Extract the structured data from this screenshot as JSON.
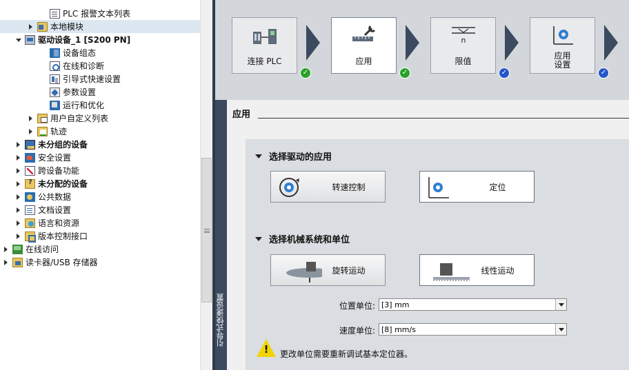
{
  "tree": {
    "items": [
      {
        "label": "PLC 报警文本列表",
        "arrow": "none",
        "icon": "doc",
        "bold": false
      },
      {
        "label": "本地模块",
        "arrow": "collapsed",
        "icon": "folder",
        "bold": false,
        "selected": true
      },
      {
        "label": "驱动设备_1 [S200 PN]",
        "arrow": "expanded",
        "icon": "drive",
        "bold": true
      },
      {
        "label": "设备组态",
        "arrow": "none",
        "icon": "config",
        "bold": false
      },
      {
        "label": "在线和诊断",
        "arrow": "none",
        "icon": "diag",
        "bold": false
      },
      {
        "label": "引导式快速设置",
        "arrow": "none",
        "icon": "wizard",
        "bold": false
      },
      {
        "label": "参数设置",
        "arrow": "none",
        "icon": "param",
        "bold": false
      },
      {
        "label": "运行和优化",
        "arrow": "none",
        "icon": "run",
        "bold": false
      },
      {
        "label": "用户自定义列表",
        "arrow": "collapsed",
        "icon": "userlist",
        "bold": false
      },
      {
        "label": "轨迹",
        "arrow": "collapsed",
        "icon": "trace",
        "bold": false
      },
      {
        "label": "未分组的设备",
        "arrow": "collapsed",
        "icon": "ungroup",
        "bold": true
      },
      {
        "label": "安全设置",
        "arrow": "collapsed",
        "icon": "security",
        "bold": false
      },
      {
        "label": "跨设备功能",
        "arrow": "collapsed",
        "icon": "cross",
        "bold": false
      },
      {
        "label": "未分配的设备",
        "arrow": "collapsed",
        "icon": "unassigned",
        "bold": true
      },
      {
        "label": "公共数据",
        "arrow": "collapsed",
        "icon": "common",
        "bold": false
      },
      {
        "label": "文档设置",
        "arrow": "collapsed",
        "icon": "docset",
        "bold": false
      },
      {
        "label": "语言和资源",
        "arrow": "collapsed",
        "icon": "lang",
        "bold": false
      },
      {
        "label": "版本控制接口",
        "arrow": "collapsed",
        "icon": "version",
        "bold": false
      },
      {
        "label": "在线访问",
        "arrow": "collapsed",
        "icon": "online",
        "bold": false
      },
      {
        "label": "读卡器/USB 存储器",
        "arrow": "collapsed",
        "icon": "cardreader",
        "bold": false
      }
    ]
  },
  "steps": [
    {
      "label": "连接 PLC",
      "status": "ok",
      "active": false,
      "icon": "plc-connection-icon"
    },
    {
      "label": "应用",
      "status": "ok",
      "active": true,
      "icon": "wrench-ruler-icon"
    },
    {
      "label": "限值",
      "status": "todo",
      "active": false,
      "icon": "limits-icon"
    },
    {
      "label": "应用\n设置",
      "status": "todo",
      "active": false,
      "icon": "gear-axes-icon"
    }
  ],
  "section": {
    "title": "应用",
    "side_label": "引导式快速设置"
  },
  "drive_app": {
    "header": "选择驱动的应用",
    "options": [
      {
        "label": "转速控制",
        "selected": false,
        "icon": "speed-control-icon"
      },
      {
        "label": "定位",
        "selected": true,
        "icon": "positioning-icon"
      }
    ]
  },
  "mechanics": {
    "header": "选择机械系统和单位",
    "options": [
      {
        "label": "旋转运动",
        "selected": false,
        "icon": "rotary-motion-icon"
      },
      {
        "label": "线性运动",
        "selected": true,
        "icon": "linear-motion-icon"
      }
    ],
    "position_unit_label": "位置单位:",
    "position_unit_value": "[3] mm",
    "speed_unit_label": "速度单位:",
    "speed_unit_value": "[8] mm/s",
    "warning_text": "更改单位需要重新调试基本定位器。"
  },
  "colors": {
    "splitter": "#2f3a4a",
    "arrow": "#3b4a5e",
    "status_ok": "#2aa02a",
    "status_todo": "#2456c8",
    "warning": "#f2d400"
  }
}
